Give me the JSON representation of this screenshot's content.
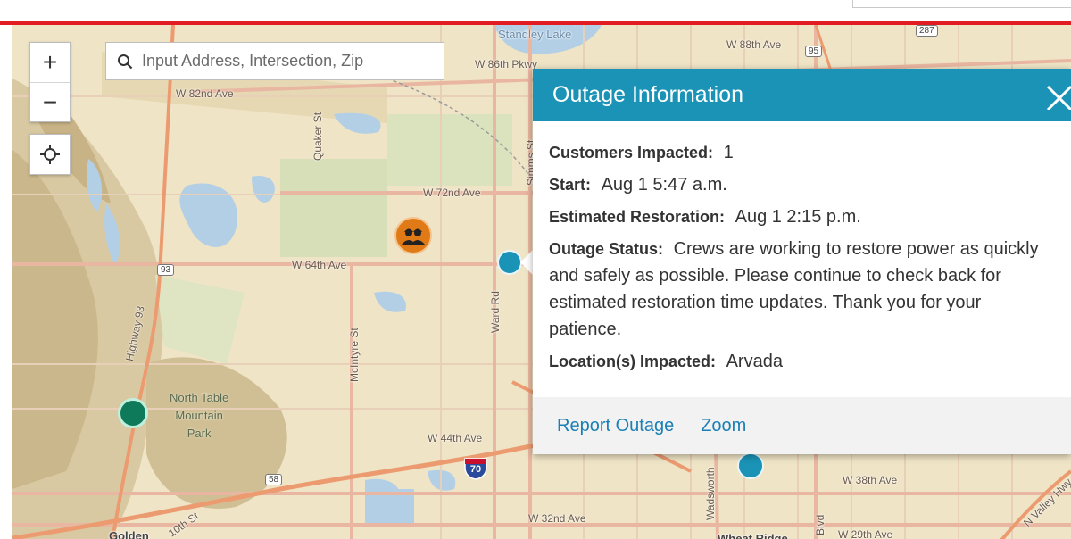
{
  "search": {
    "placeholder": "Input Address, Intersection, Zip"
  },
  "controls": {
    "zoom_in": "+",
    "zoom_out": "−"
  },
  "map_labels": {
    "standley_lake": "Standley Lake",
    "w88th": "W 88th Ave",
    "w86th": "W 86th Pkwy",
    "w82nd": "W 82nd Ave",
    "w72nd": "W 72nd Ave",
    "w64th": "W 64th Ave",
    "w44th": "W 44th Ave",
    "w38th": "W 38th Ave",
    "w32nd": "W 32nd Ave",
    "w29th": "W 29th Ave",
    "quaker": "Quaker St",
    "simms": "Simms St",
    "mcintyre": "McIntyre St",
    "ward": "Ward Rd",
    "wadsworth": "Wadsworth",
    "highway93": "Highway 93",
    "blvd": "Blvd",
    "tenth": "10th St",
    "golden": "Golden",
    "wheat_ridge": "Wheat Ridge",
    "n_valley": "N Valley Hwy",
    "park_line1": "North Table",
    "park_line2": "Mountain",
    "park_line3": "Park",
    "shield_93": "93",
    "shield_95": "95",
    "shield_58": "58",
    "shield_287": "287",
    "i70": "70"
  },
  "popup": {
    "title": "Outage Information",
    "customers_label": "Customers Impacted:",
    "customers_value": "1",
    "start_label": "Start:",
    "start_value": "Aug 1 5:47 a.m.",
    "est_label": "Estimated Restoration:",
    "est_value": "Aug 1 2:15 p.m.",
    "status_label": "Outage Status:",
    "status_value": "Crews are working to restore power as quickly and safely as possible. Please continue to check back for estimated restoration time updates. Thank you for your patience.",
    "location_label": "Location(s) Impacted:",
    "location_value": "Arvada",
    "report_link": "Report Outage",
    "zoom_link": "Zoom"
  },
  "colors": {
    "header": "#1a93b6",
    "accent_red": "#e31b23",
    "marker_teal": "#1a93b6",
    "marker_green": "#0f7a5a",
    "crew_orange": "#e07a16"
  },
  "icons": [
    "search-icon",
    "locate-icon",
    "close-icon",
    "crew-icon"
  ]
}
